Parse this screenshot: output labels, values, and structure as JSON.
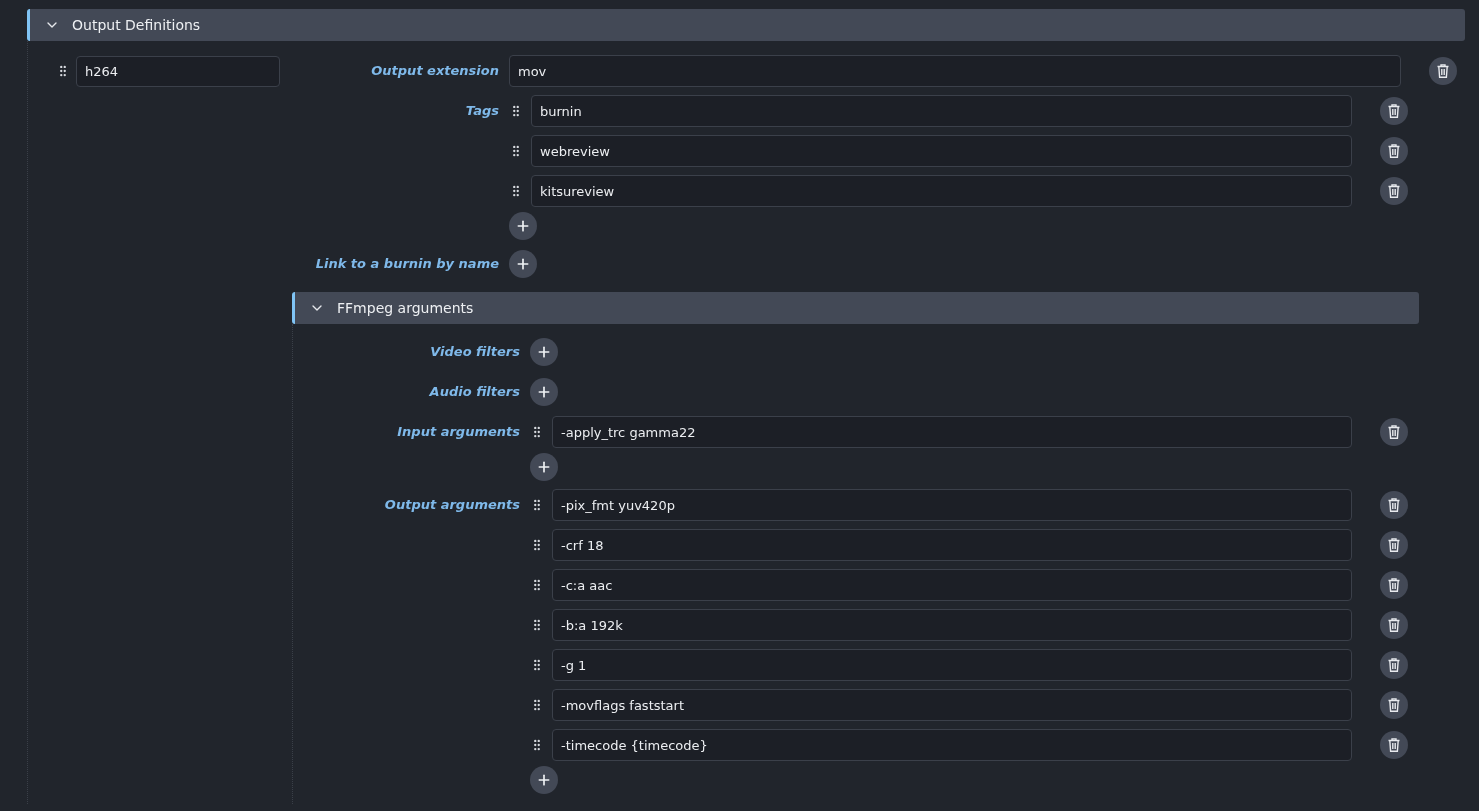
{
  "section": {
    "title": "Output Definitions",
    "expanded": true
  },
  "definition": {
    "name": "h264"
  },
  "fields": [
    {
      "kind": "text",
      "label": "Output extension",
      "value": "mov"
    },
    {
      "kind": "list",
      "label": "Tags",
      "items": [
        "burnin",
        "webreview",
        "kitsureview"
      ]
    },
    {
      "kind": "add",
      "label": "Link to a burnin by name"
    }
  ],
  "ffmpeg": {
    "title": "FFmpeg arguments",
    "expanded": true,
    "fields": [
      {
        "kind": "add",
        "label": "Video filters"
      },
      {
        "kind": "add",
        "label": "Audio filters"
      },
      {
        "kind": "list",
        "label": "Input arguments",
        "items": [
          "-apply_trc gamma22"
        ]
      },
      {
        "kind": "list",
        "label": "Output arguments",
        "items": [
          "-pix_fmt yuv420p",
          "-crf 18",
          "-c:a aac",
          "-b:a 192k",
          "-g 1",
          "-movflags faststart",
          "-timecode {timecode}"
        ]
      }
    ]
  }
}
